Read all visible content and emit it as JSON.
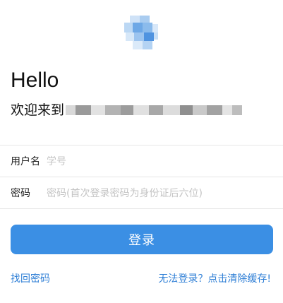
{
  "header": {
    "logo_icon": "blurred-logo",
    "greeting": "Hello",
    "welcome_prefix": "欢迎来到"
  },
  "form": {
    "username_label": "用户名",
    "username_placeholder": "学号",
    "username_value": "",
    "password_label": "密码",
    "password_placeholder": "密码(首次登录密码为身份证后六位)",
    "password_value": "",
    "login_label": "登录"
  },
  "links": {
    "recover_password": "找回密码",
    "clear_cache": "无法登录？点击清除缓存!"
  },
  "colors": {
    "accent": "#3b8fe4",
    "link": "#2f7fd6",
    "placeholder": "#c4c4c4",
    "divider": "#e6e6e6"
  }
}
